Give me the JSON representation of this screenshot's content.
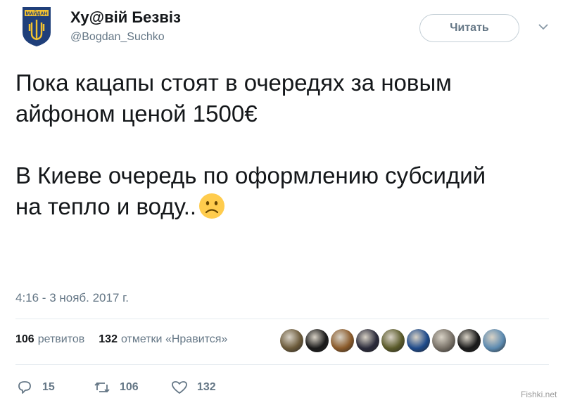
{
  "author": {
    "name": "Ху@вій Безвіз",
    "handle": "@Bogdan_Suchko",
    "avatar_icon": "maidan-trident-shield-icon"
  },
  "header": {
    "follow_label": "Читать",
    "menu_icon": "chevron-down-icon"
  },
  "tweet": {
    "line1": "Пока кацапы стоят в очередях за новым",
    "line2": "айфоном ценой 1500€",
    "line3": "В Киеве очередь по оформлению субсидий",
    "line4": "на тепло и воду..",
    "emoji": "frowning-face-emoji"
  },
  "timestamp": "4:16 - 3 нояб. 2017 г.",
  "stats": {
    "retweets_count": "106",
    "retweets_label": "ретвитов",
    "likes_count": "132",
    "likes_label": "отметки «Нравится»"
  },
  "likers": [
    {
      "icon": "liker-avatar-1",
      "color": "#6b5a3a"
    },
    {
      "icon": "liker-avatar-2",
      "color": "#1a1a1a"
    },
    {
      "icon": "liker-avatar-3",
      "color": "#8a5a2a"
    },
    {
      "icon": "liker-avatar-4",
      "color": "#2a2a3a"
    },
    {
      "icon": "liker-avatar-5",
      "color": "#5a5a2a"
    },
    {
      "icon": "liker-avatar-6",
      "color": "#1e4a8a"
    },
    {
      "icon": "liker-avatar-7",
      "color": "#777066"
    },
    {
      "icon": "liker-avatar-8",
      "color": "#1a1a1a"
    },
    {
      "icon": "liker-avatar-9",
      "color": "#5c8ab0"
    }
  ],
  "actions": {
    "reply_count": "15",
    "retweet_count": "106",
    "like_count": "132"
  },
  "watermark": "Fishki.net"
}
